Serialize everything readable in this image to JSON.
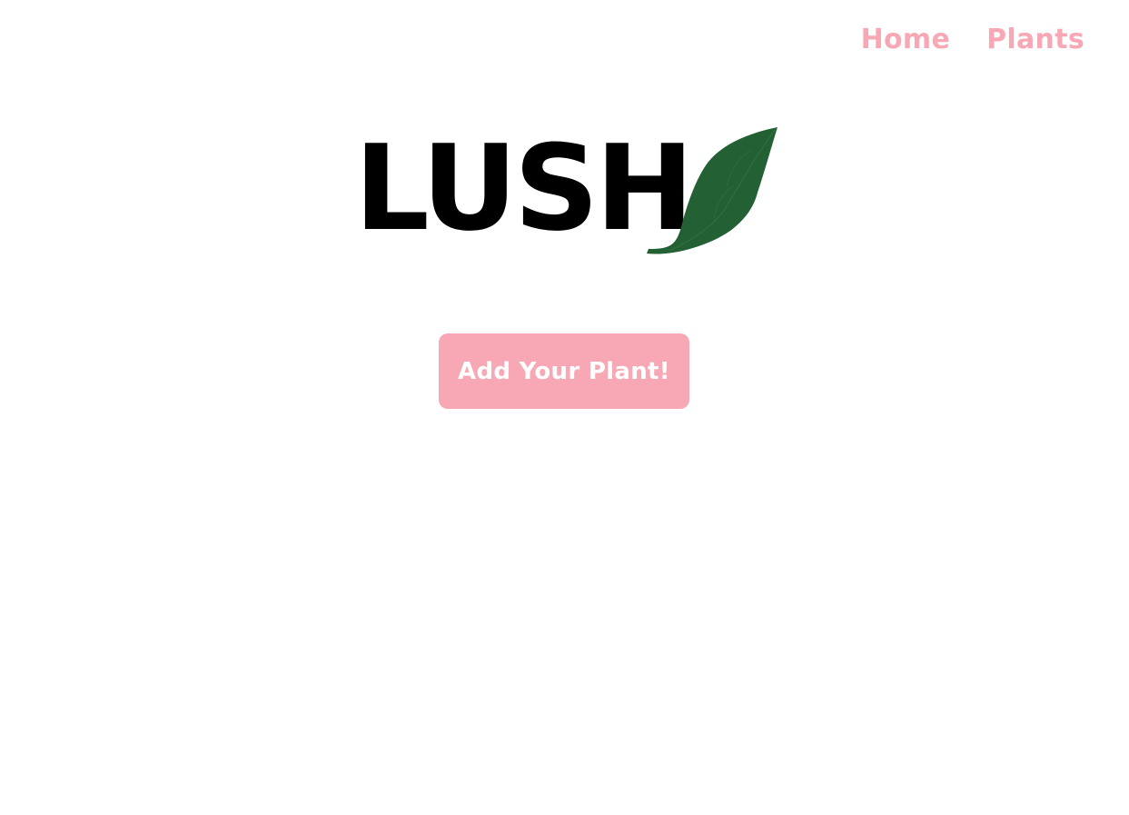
{
  "nav": {
    "items": [
      {
        "label": "Home"
      },
      {
        "label": "Plants"
      }
    ]
  },
  "logo": {
    "text": "LUSH",
    "icon": "leaf-icon"
  },
  "main": {
    "add_button_label": "Add Your Plant!"
  },
  "colors": {
    "accent": "#f7a8b4",
    "leaf": "#236134",
    "text": "#000000",
    "background": "#ffffff"
  }
}
